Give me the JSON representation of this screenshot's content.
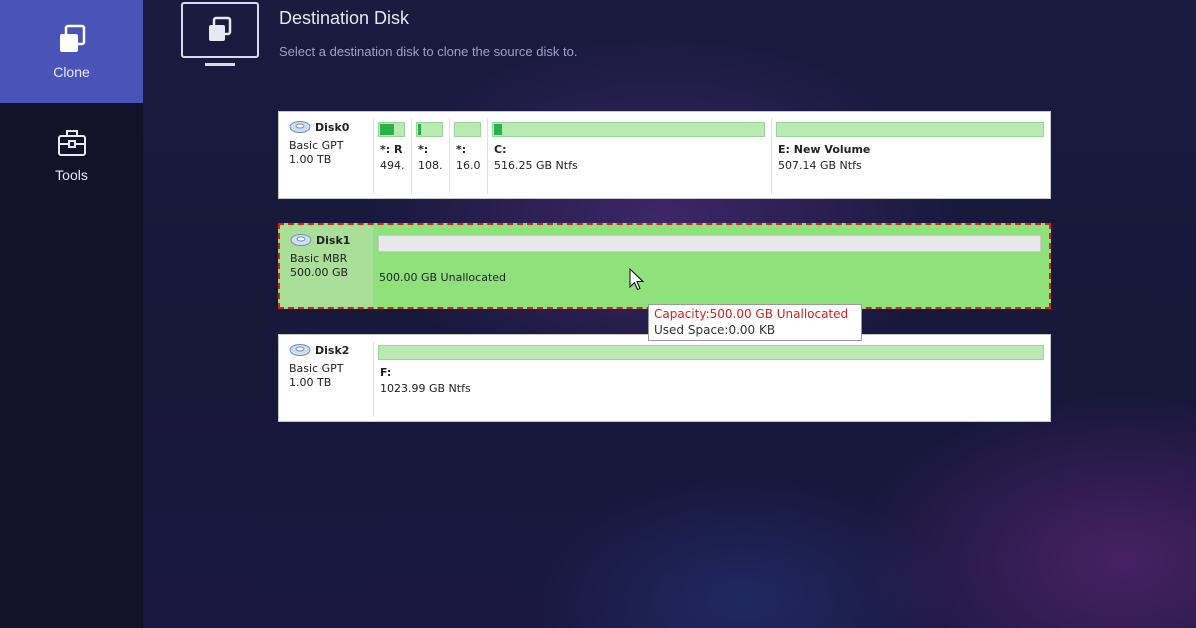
{
  "sidebar": {
    "items": [
      {
        "label": "Clone",
        "icon": "clone-icon",
        "active": true
      },
      {
        "label": "Tools",
        "icon": "toolbox-icon",
        "active": false
      }
    ]
  },
  "header": {
    "title": "Destination Disk",
    "subtitle": "Select a destination disk to clone the source disk to.",
    "icon": "monitor-clone-icon"
  },
  "disks": [
    {
      "name": "Disk0",
      "type": "Basic GPT",
      "size": "1.00 TB",
      "partitions": [
        {
          "label": "*: R",
          "size": "494.",
          "fill": 0.55
        },
        {
          "label": "*:",
          "size": "108.",
          "fill": 0.1
        },
        {
          "label": "*:",
          "size": "16.0",
          "fill": 0.0
        },
        {
          "label": "C:",
          "size": "516.25 GB Ntfs",
          "fill": 0.04
        },
        {
          "label": "E: New Volume",
          "size": "507.14 GB Ntfs",
          "fill": 0.0
        }
      ]
    },
    {
      "name": "Disk1",
      "type": "Basic MBR",
      "size": "500.00 GB",
      "selected": true,
      "unallocated": "500.00 GB Unallocated"
    },
    {
      "name": "Disk2",
      "type": "Basic GPT",
      "size": "1.00 TB",
      "partitions": [
        {
          "label": "F:",
          "size": "1023.99 GB Ntfs",
          "fill": 0.0
        }
      ]
    }
  ],
  "tooltip": {
    "capacity": "Capacity:500.00 GB Unallocated",
    "used": "Used Space:0.00 KB"
  },
  "colors": {
    "sidebar_active": "#4a54b8",
    "selected_disk": "#8fe27b",
    "selection_border": "#d22222",
    "partition_bar": "#b9eab2",
    "partition_fill": "#27b24a"
  }
}
